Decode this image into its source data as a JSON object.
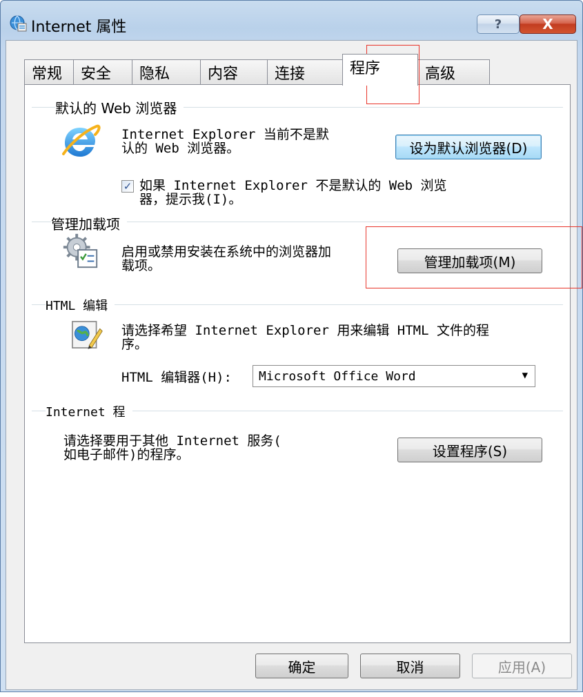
{
  "window": {
    "title": "Internet 属性",
    "help_label": "?",
    "close_label": "X"
  },
  "tabs": [
    {
      "label": "常规"
    },
    {
      "label": "安全"
    },
    {
      "label": "隐私"
    },
    {
      "label": "内容"
    },
    {
      "label": "连接"
    },
    {
      "label": "程序"
    },
    {
      "label": "高级"
    }
  ],
  "default_browser": {
    "group_label": "默认的 Web 浏览器",
    "status_text_1": "Internet Explorer 当前不是默",
    "status_text_2": "认的 Web 浏览器。",
    "set_default_button": "设为默认浏览器(D)",
    "prompt_checkbox_line_1": "如果 Internet Explorer 不是默认的 Web 浏览",
    "prompt_checkbox_line_2": "器，提示我(I)。",
    "prompt_checked": true
  },
  "addons": {
    "group_label": "管理加载项",
    "description_1": "启用或禁用安装在系统中的浏览器加",
    "description_2": "载项。",
    "manage_button": "管理加载项(M)"
  },
  "html_editing": {
    "group_label": "HTML 编辑",
    "description_1": "请选择希望 Internet Explorer 用来编辑 HTML 文件的程",
    "description_2": "序。",
    "editor_label": "HTML 编辑器(H):",
    "editor_value": "Microsoft Office Word"
  },
  "internet_programs": {
    "group_label": "Internet 程",
    "description_1": "请选择要用于其他 Internet 服务(",
    "description_2": "如电子邮件)的程序。",
    "set_programs_button": "设置程序(S)"
  },
  "footer": {
    "ok_button": "确定",
    "cancel_button": "取消",
    "apply_button": "应用(A)"
  },
  "colors": {
    "highlight": "#e8342a",
    "title_bar": "#b9d1ea",
    "close_button": "#c23c20"
  }
}
